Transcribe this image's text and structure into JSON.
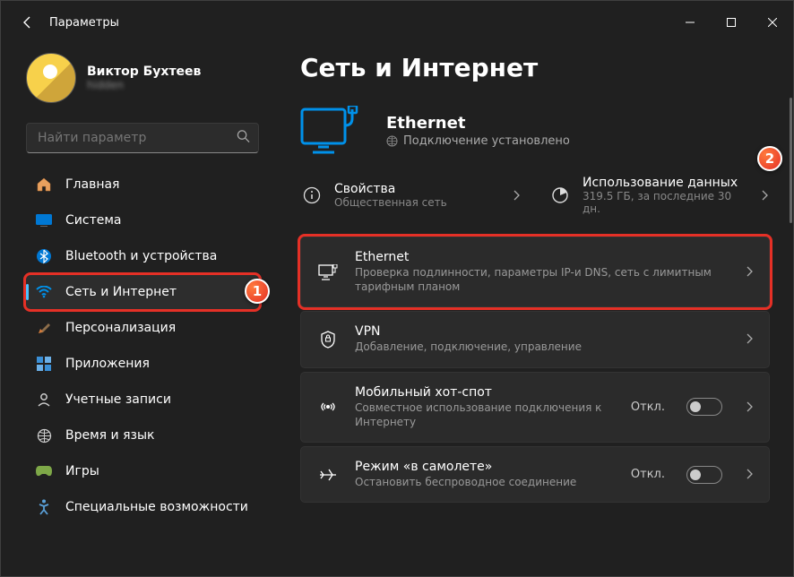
{
  "window": {
    "title": "Параметры"
  },
  "profile": {
    "name": "Виктор Бухтеев",
    "email": "hidden"
  },
  "search": {
    "placeholder": "Найти параметр"
  },
  "sidebar": {
    "items": [
      {
        "label": "Главная"
      },
      {
        "label": "Система"
      },
      {
        "label": "Bluetooth и устройства"
      },
      {
        "label": "Сеть и Интернет"
      },
      {
        "label": "Персонализация"
      },
      {
        "label": "Приложения"
      },
      {
        "label": "Учетные записи"
      },
      {
        "label": "Время и язык"
      },
      {
        "label": "Игры"
      },
      {
        "label": "Специальные возможности"
      }
    ]
  },
  "page": {
    "title": "Сеть и Интернет",
    "status": {
      "title": "Ethernet",
      "subtitle": "Подключение установлено"
    },
    "info": {
      "props": {
        "title": "Свойства",
        "subtitle": "Общественная сеть"
      },
      "data": {
        "title": "Использование данных",
        "subtitle": "319.5 ГБ, за последние 30 дн."
      }
    },
    "cards": [
      {
        "title": "Ethernet",
        "subtitle": "Проверка подлинности, параметры IP-и DNS, сеть с лимитным тарифным планом"
      },
      {
        "title": "VPN",
        "subtitle": "Добавление, подключение, управление"
      },
      {
        "title": "Мобильный хот-спот",
        "subtitle": "Совместное использование подключения к Интернету",
        "state": "Откл."
      },
      {
        "title": "Режим «в самолете»",
        "subtitle": "Остановить беспроводное соединение",
        "state": "Откл."
      }
    ]
  },
  "markers": {
    "one": "1",
    "two": "2"
  }
}
